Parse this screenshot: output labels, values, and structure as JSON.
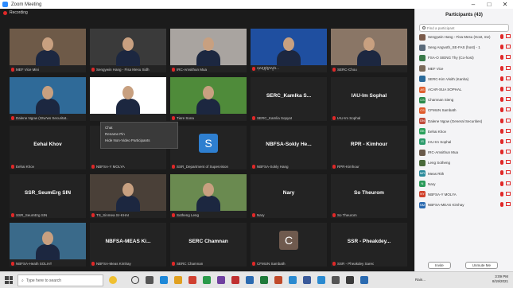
{
  "window": {
    "title": "Zoom Meeting",
    "controls": [
      "–",
      "□",
      "✕"
    ]
  },
  "meeting": {
    "recording_label": "Recording",
    "tiles": [
      {
        "tag": "MEF Vice Mini",
        "kind": "photo",
        "photo": "#6e5a48"
      },
      {
        "tag": "Sengywin Hang - Fisa Mesu Sidh",
        "kind": "photo",
        "photo": "#3a3a3a"
      },
      {
        "tag": "IRC-Amsithun Mua",
        "kind": "photo",
        "photo": "#a9a4a0"
      },
      {
        "tag": "ខុសត្រូវក្រសួង...",
        "kind": "photo",
        "photo": "#1f4fa0"
      },
      {
        "tag": "SERC-Chou",
        "kind": "photo",
        "photo": "#8a7666"
      },
      {
        "tag": "Dalene Ngow (Gtw'ws Securitat..",
        "kind": "photo",
        "photo": "#2f6a98"
      },
      {
        "tag": "",
        "kind": "photo",
        "photo": "#ffffff"
      },
      {
        "tag": "Tiere Sona",
        "kind": "photo",
        "photo": "#4f8b3a"
      },
      {
        "tag": "SERC_Kamlia Sopyat",
        "kind": "name",
        "name": "SERC_Kamlka S..."
      },
      {
        "tag": "IAU-Im Sophal",
        "kind": "name",
        "name": "IAU-Im Sophal"
      },
      {
        "tag": "Eehai Khov",
        "kind": "name",
        "name": "Eehai Khov"
      },
      {
        "tag": "NBFSA-Y MOLYA",
        "kind": "name",
        "name": "NBFSA- Y MOLY..."
      },
      {
        "tag": "SSR_Department of Supervision",
        "kind": "avatar",
        "letter": "S",
        "color": "#2e7fd0"
      },
      {
        "tag": "NBFSA-Sokly Hang",
        "kind": "name",
        "name": "NBFSA-Sokly He..."
      },
      {
        "tag": "RPR-Kimhour",
        "kind": "name",
        "name": "RPR - Kimhour"
      },
      {
        "tag": "SSR_SeumErg SIN",
        "kind": "name",
        "name": "SSR_SeumErg SIN"
      },
      {
        "tag": "TS_Sinmea Sr-KHAI",
        "kind": "photo",
        "photo": "#4a4038"
      },
      {
        "tag": "Sotheng Leng",
        "kind": "photo",
        "photo": "#6a8a50"
      },
      {
        "tag": "Nary",
        "kind": "name",
        "name": "Nary"
      },
      {
        "tag": "So Theurom",
        "kind": "name",
        "name": "So Theurom"
      },
      {
        "tag": "NBFSA-Heath SOLIAT",
        "kind": "photo",
        "photo": "#3a6a8a"
      },
      {
        "tag": "NBFSA-Meas Kimhay",
        "kind": "name",
        "name": "NBFSA-MEAS Ki..."
      },
      {
        "tag": "SERC Chamnan",
        "kind": "name",
        "name": "SERC Chamnan"
      },
      {
        "tag": "CFMUN Sambath",
        "kind": "avatar",
        "letter": "C",
        "color": "#6f5a4e"
      },
      {
        "tag": "SSR - Pheakdey Sarec",
        "kind": "name",
        "name": "SSR - Pheakdey..."
      }
    ],
    "context_menu": [
      "Chat",
      "Rename Pin",
      "Hide Non-Video Participants"
    ]
  },
  "participants": {
    "title": "Participants (43)",
    "search_placeholder": "Find a participant",
    "items": [
      {
        "name": "Sengywin Hang - Fisa Mesu (Host, me)",
        "color": "#7a5a4a",
        "initials": ""
      },
      {
        "name": "Seng Angvoth_SE-FAS (host) - 1",
        "color": "#5a6a7a",
        "initials": ""
      },
      {
        "name": "FSA-O SIENG Thy (Co-host)",
        "color": "#3a7a4a",
        "initials": ""
      },
      {
        "name": "MEF Vice",
        "color": "#7a6a5a",
        "initials": ""
      },
      {
        "name": "SERC-Kim Visith (Kanha)",
        "color": "#2a6a9a",
        "initials": ""
      },
      {
        "name": "ACAR-SUA SOPHAL",
        "color": "#e06030",
        "initials": "AS"
      },
      {
        "name": "Chamnan Sieng",
        "color": "#2a8a4a",
        "initials": "CS"
      },
      {
        "name": "CFMUN Sambath",
        "color": "#e05a2a",
        "initials": "CS"
      },
      {
        "name": "Dalene Ngow (General Securities)",
        "color": "#c04a3a",
        "initials": "DN"
      },
      {
        "name": "Eehai Khov",
        "color": "#2aa05a",
        "initials": "EK"
      },
      {
        "name": "IAU-Im Sophal",
        "color": "#2a9a6a",
        "initials": "IS"
      },
      {
        "name": "IRC-Amsithun Mua",
        "color": "#6a5a4a",
        "initials": ""
      },
      {
        "name": "Leng Sotheng",
        "color": "#4a6a3a",
        "initials": ""
      },
      {
        "name": "Meas Rith",
        "color": "#2a8a9a",
        "initials": "MR"
      },
      {
        "name": "Nary",
        "color": "#2a9a5a",
        "initials": "N"
      },
      {
        "name": "NBFSA-Y MOLYA",
        "color": "#d0402a",
        "initials": "NY"
      },
      {
        "name": "NBFSA-MEAS Kimhay",
        "color": "#2a6ab0",
        "initials": "NM"
      }
    ],
    "invite_label": "Invite",
    "unmute_label": "Unmute Me"
  },
  "taskbar": {
    "search_placeholder": "Type here to search",
    "tray_text": "Rain...",
    "time": "3:09 PM",
    "date": "8/19/2021"
  }
}
